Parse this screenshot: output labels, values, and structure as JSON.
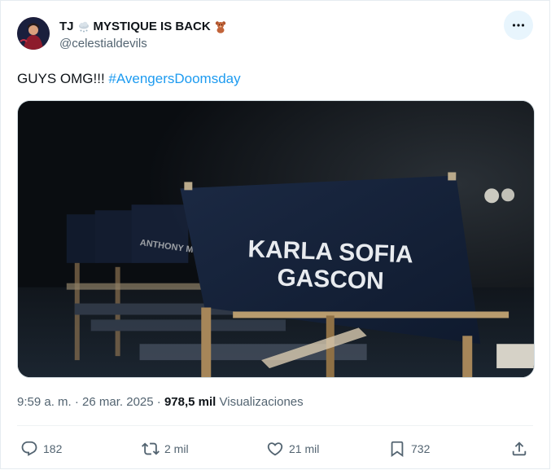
{
  "author": {
    "display_name_prefix": "TJ",
    "display_name_main": "MYSTIQUE IS BACK",
    "emoji_1": "cloud-snow-emoji",
    "emoji_2": "teddy-bear-emoji",
    "handle": "@celestialdevils"
  },
  "tweet": {
    "text": "GUYS OMG!!! ",
    "hashtag": "#AvengersDoomsday"
  },
  "media": {
    "chair_name_line1": "KARLA SOFIA",
    "chair_name_line2": "GASCON",
    "background_chair_text": "ANTHONY M"
  },
  "meta": {
    "time": "9:59 a. m.",
    "separator1": " · ",
    "date": "26 mar. 2025",
    "separator2": " · ",
    "views_count": "978,5 mil",
    "views_label": " Visualizaciones"
  },
  "actions": {
    "replies": "182",
    "retweets": "2 mil",
    "likes": "21 mil",
    "bookmarks": "732"
  },
  "icons": {
    "more": "more-dots-icon",
    "reply": "reply-icon",
    "retweet": "retweet-icon",
    "like": "heart-icon",
    "bookmark": "bookmark-icon",
    "share": "share-icon"
  },
  "colors": {
    "accent": "#1d9bf0",
    "secondary_text": "#536471",
    "primary_text": "#0f1419"
  }
}
